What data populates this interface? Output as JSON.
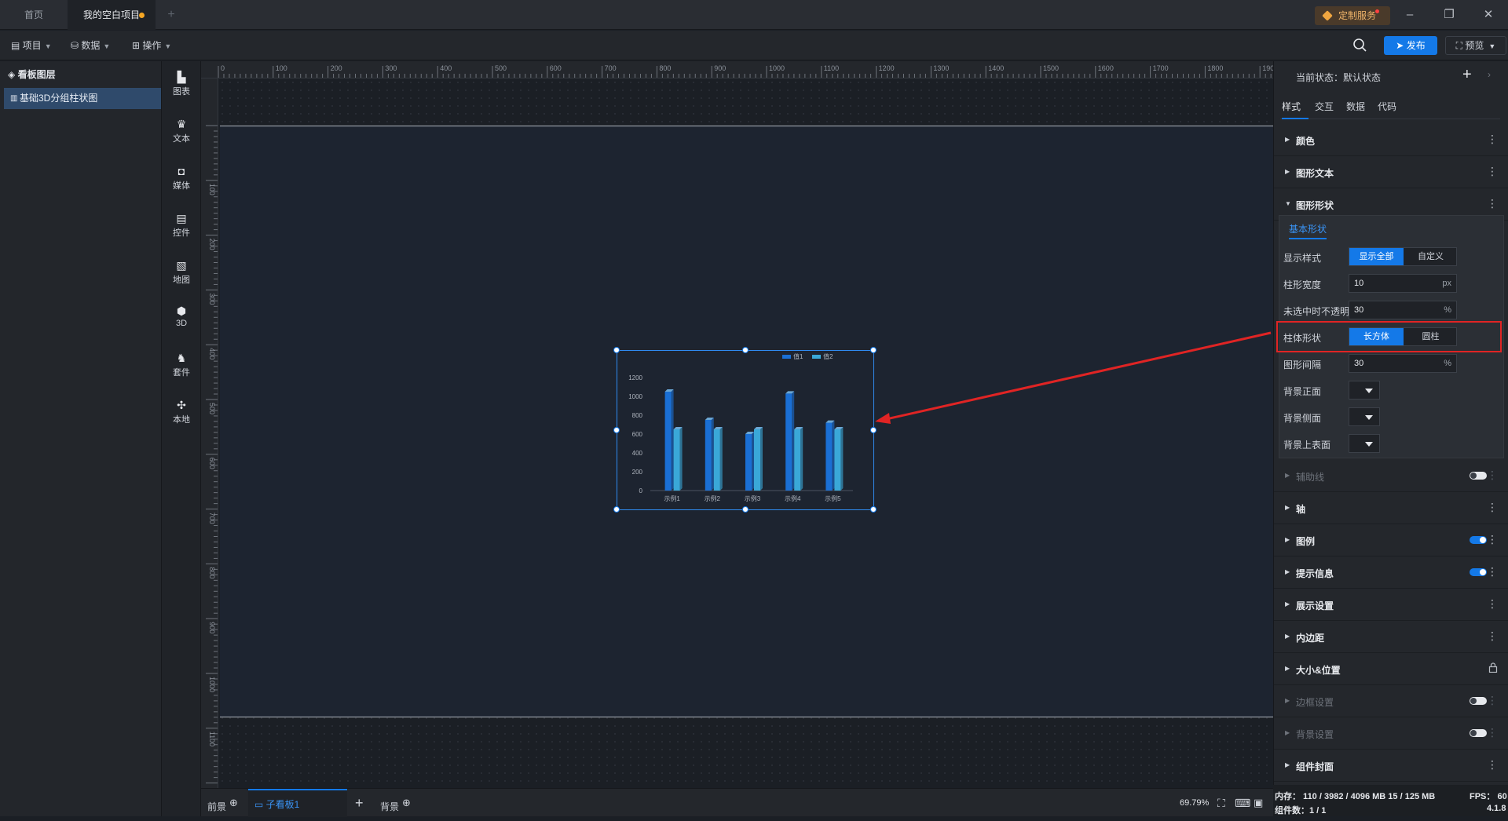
{
  "titlebar": {
    "tabs": [
      {
        "label": "首页"
      },
      {
        "label": "我的空白项目"
      }
    ],
    "custom_service": "定制服务"
  },
  "toolbar": {
    "menus": [
      {
        "label": "项目"
      },
      {
        "label": "数据"
      },
      {
        "label": "操作"
      }
    ],
    "publish": "发布",
    "preview": "预览"
  },
  "layers": {
    "title": "看板图层",
    "items": [
      {
        "label": "基础3D分组柱状图"
      }
    ]
  },
  "components": [
    {
      "label": "图表",
      "icon": "bar-chart-icon"
    },
    {
      "label": "文本",
      "icon": "text-icon"
    },
    {
      "label": "媒体",
      "icon": "media-icon"
    },
    {
      "label": "控件",
      "icon": "control-icon"
    },
    {
      "label": "地图",
      "icon": "map-icon"
    },
    {
      "label": "3D",
      "icon": "cube-icon"
    },
    {
      "label": "套件",
      "icon": "shirt-icon"
    },
    {
      "label": "本地",
      "icon": "puzzle-icon"
    }
  ],
  "rulers": {
    "top": [
      "0",
      "100",
      "200",
      "300",
      "400",
      "500",
      "600",
      "700",
      "800",
      "900",
      "1000",
      "1100",
      "1200",
      "1300",
      "1400",
      "1500",
      "1600",
      "1700",
      "1800",
      "1900"
    ],
    "left": [
      "100",
      "200",
      "300",
      "400",
      "500",
      "600",
      "700",
      "800",
      "900",
      "1000",
      "1100"
    ]
  },
  "chart_data": {
    "type": "bar",
    "categories": [
      "示例1",
      "示例2",
      "示例3",
      "示例4",
      "示例5"
    ],
    "series": [
      {
        "name": "值1",
        "values": [
          1050,
          750,
          600,
          1030,
          720
        ],
        "color": "#1a6fd4"
      },
      {
        "name": "值2",
        "values": [
          650,
          650,
          650,
          650,
          650
        ],
        "color": "#3aa8d8"
      }
    ],
    "y_ticks": [
      "0",
      "200",
      "400",
      "600",
      "800",
      "1000",
      "1200"
    ],
    "ylim": [
      0,
      1200
    ],
    "legend": "top-right"
  },
  "props": {
    "state": "当前状态：默认状态",
    "tabs": [
      {
        "label": "样式"
      },
      {
        "label": "交互"
      },
      {
        "label": "数据"
      },
      {
        "label": "代码"
      }
    ],
    "sections_top": [
      {
        "label": "颜色"
      },
      {
        "label": "图形文本"
      },
      {
        "label": "图形形状"
      }
    ],
    "shape": {
      "tab": "基本形状",
      "display_style": {
        "label": "显示样式",
        "options": [
          "显示全部",
          "自定义"
        ],
        "selected": "显示全部"
      },
      "bar_width": {
        "label": "柱形宽度",
        "value": "10",
        "unit": "px"
      },
      "unselected_opacity": {
        "label": "未选中时不透明度",
        "value": "30",
        "unit": "%"
      },
      "bar_shape": {
        "label": "柱体形状",
        "options": [
          "长方体",
          "圆柱"
        ],
        "selected": "长方体"
      },
      "gap": {
        "label": "图形间隔",
        "value": "30",
        "unit": "%"
      },
      "bg_front": {
        "label": "背景正面"
      },
      "bg_side": {
        "label": "背景侧面"
      },
      "bg_top": {
        "label": "背景上表面"
      }
    },
    "sections_bottom": [
      {
        "label": "辅助线",
        "toggle": "off",
        "dim": true
      },
      {
        "label": "轴"
      },
      {
        "label": "图例",
        "toggle": "on"
      },
      {
        "label": "提示信息",
        "toggle": "on"
      },
      {
        "label": "展示设置"
      },
      {
        "label": "内边距"
      },
      {
        "label": "大小&位置",
        "lock": true
      },
      {
        "label": "边框设置",
        "toggle": "off",
        "dim": true
      },
      {
        "label": "背景设置",
        "toggle": "off",
        "dim": true
      },
      {
        "label": "组件封面"
      }
    ]
  },
  "bottom": {
    "tabs": [
      {
        "label": "前景"
      },
      {
        "label": "子看板1"
      },
      {
        "label": "背景"
      }
    ],
    "zoom": "69.79%"
  },
  "status": {
    "memory": "内存：  110 / 3982 / 4096 MB  15 / 125 MB",
    "fps": "FPS：  60",
    "components": "组件数：1 / 1",
    "version": "4.1.8"
  },
  "colors": {
    "accent": "#1479e8",
    "highlight": "#e02424",
    "arrow": "#e02424"
  }
}
